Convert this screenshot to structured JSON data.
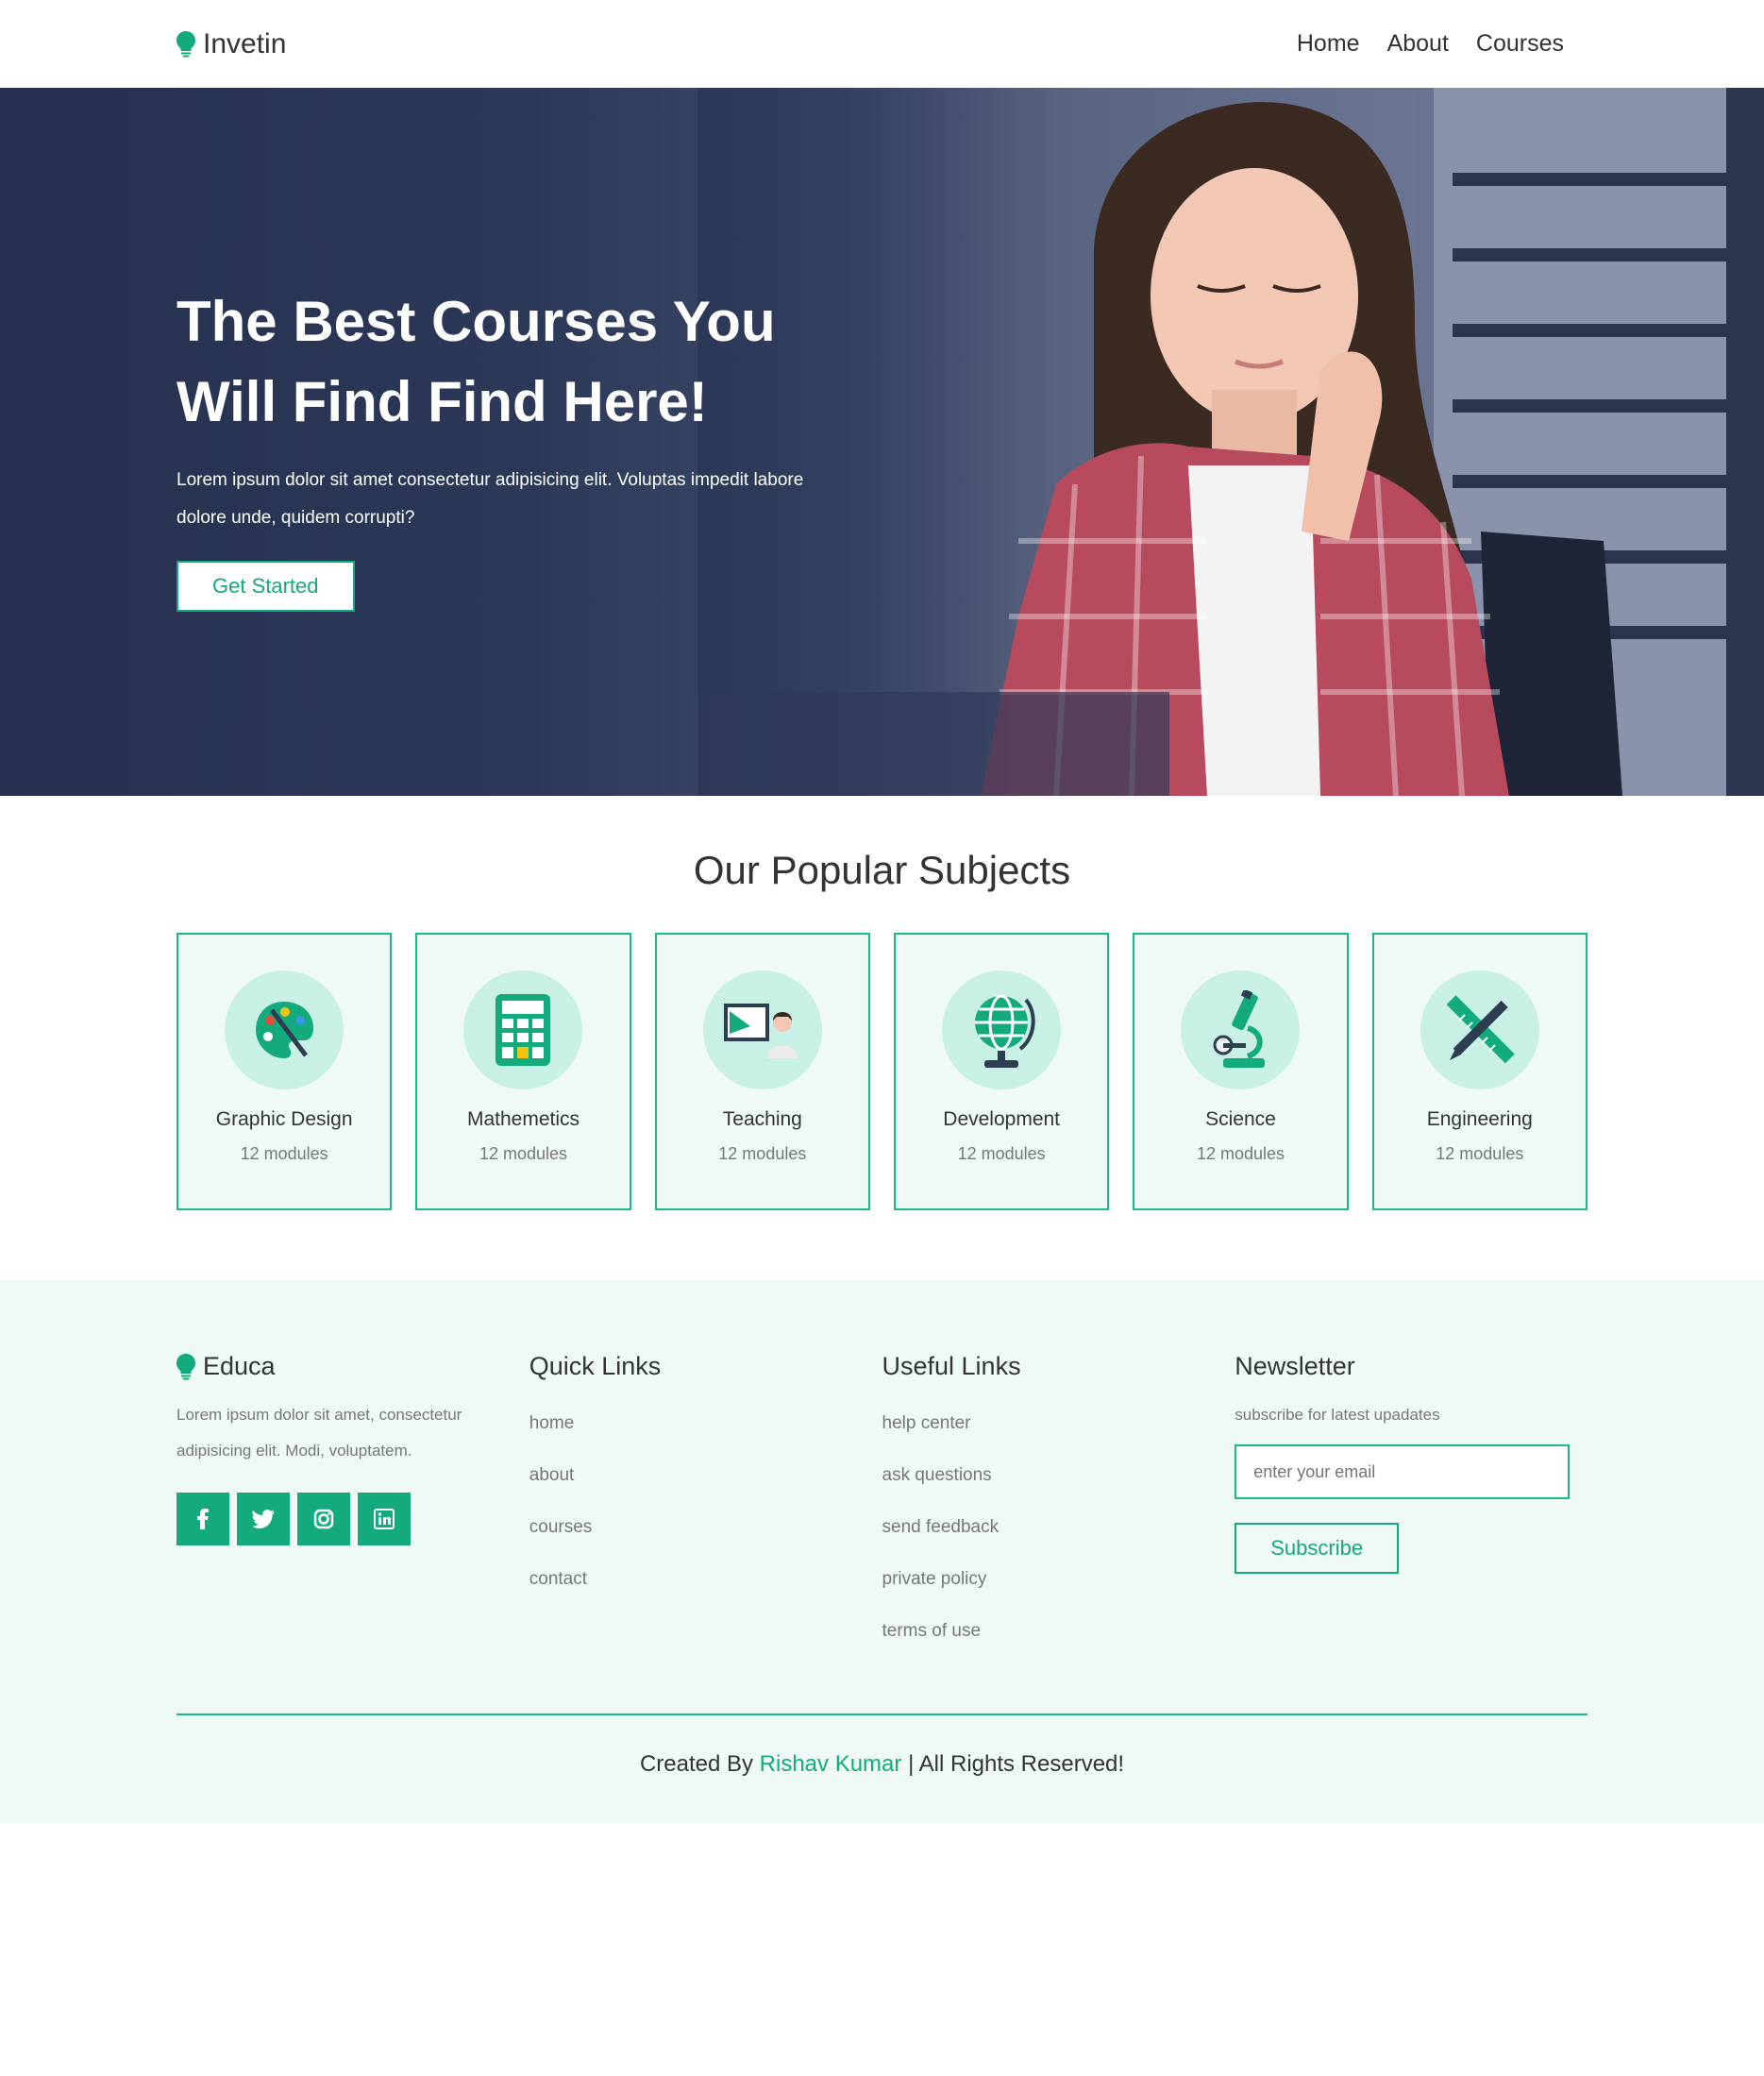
{
  "header": {
    "brand": "Invetin",
    "nav": [
      {
        "label": "Home"
      },
      {
        "label": "About"
      },
      {
        "label": "Courses"
      }
    ]
  },
  "hero": {
    "title_line1": "The Best Courses You",
    "title_line2": "Will Find Find Here!",
    "description": "Lorem ipsum dolor sit amet consectetur adipisicing elit. Voluptas impedit labore dolore unde, quidem corrupti?",
    "cta_label": "Get Started"
  },
  "subjects": {
    "heading": "Our Popular Subjects",
    "items": [
      {
        "title": "Graphic Design",
        "meta": "12 modules",
        "icon": "palette-icon"
      },
      {
        "title": "Mathemetics",
        "meta": "12 modules",
        "icon": "calculator-icon"
      },
      {
        "title": "Teaching",
        "meta": "12 modules",
        "icon": "teacher-board-icon"
      },
      {
        "title": "Development",
        "meta": "12 modules",
        "icon": "globe-icon"
      },
      {
        "title": "Science",
        "meta": "12 modules",
        "icon": "microscope-icon"
      },
      {
        "title": "Engineering",
        "meta": "12 modules",
        "icon": "ruler-pencil-icon"
      }
    ]
  },
  "footer": {
    "brand": "Educa",
    "about": "Lorem ipsum dolor sit amet, consectetur adipisicing elit. Modi, voluptatem.",
    "social": [
      "facebook-icon",
      "twitter-icon",
      "instagram-icon",
      "linkedin-icon"
    ],
    "quick_links": {
      "heading": "Quick Links",
      "items": [
        "home",
        "about",
        "courses",
        "contact"
      ]
    },
    "useful_links": {
      "heading": "Useful Links",
      "items": [
        "help center",
        "ask questions",
        "send feedback",
        "private policy",
        "terms of use"
      ]
    },
    "newsletter": {
      "heading": "Newsletter",
      "subtitle": "subscribe for latest upadates",
      "placeholder": "enter your email",
      "button": "Subscribe"
    },
    "credit_prefix": "Created By",
    "credit_name": "Rishav Kumar",
    "credit_suffix": "| All Rights Reserved!"
  },
  "colors": {
    "accent": "#13ab7d",
    "card_bg": "#effaf7",
    "hero_overlay": "#26314f"
  }
}
